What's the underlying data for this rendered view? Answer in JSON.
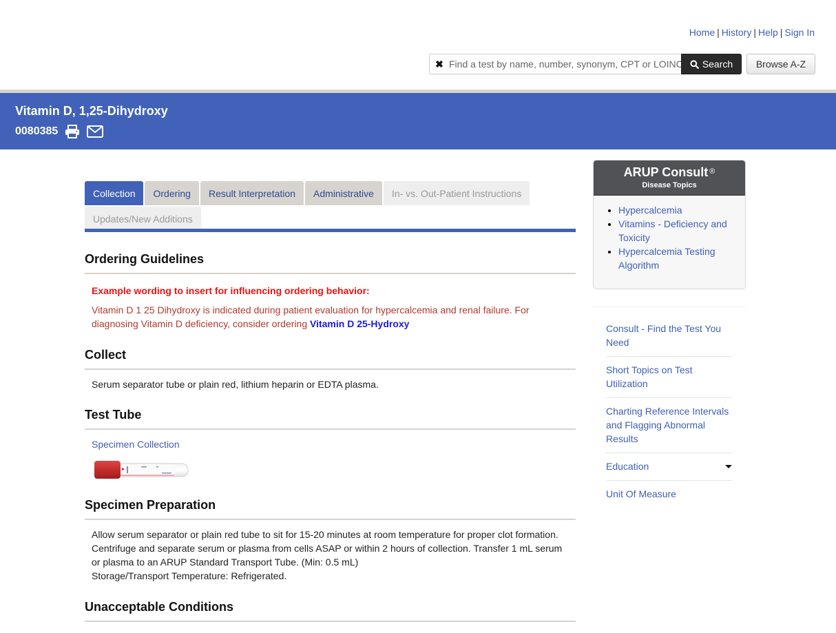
{
  "header": {
    "nav_links": [
      "Home",
      "History",
      "Help",
      "Sign In"
    ],
    "separator": "|",
    "search": {
      "placeholder": "Find a test by name, number, synonym, CPT or LOINC",
      "value": "",
      "clear_icon": "close-icon",
      "search_icon": "magnifier-icon",
      "search_label": "Search"
    },
    "browse_label": "Browse A-Z"
  },
  "banner": {
    "title": "Vitamin D, 1,25-Dihydroxy",
    "code": "0080385",
    "icons": [
      "print-icon",
      "email-icon"
    ]
  },
  "tabs": [
    {
      "label": "Collection",
      "state": "active"
    },
    {
      "label": "Ordering",
      "state": "normal"
    },
    {
      "label": "Result Interpretation",
      "state": "normal"
    },
    {
      "label": "Administrative",
      "state": "normal"
    },
    {
      "label": "In- vs. Out-Patient Instructions",
      "state": "disabled"
    },
    {
      "label": "Updates/New Additions",
      "state": "disabled"
    }
  ],
  "sections": {
    "ordering_guidelines": {
      "heading": "Ordering Guidelines",
      "warning": "Example wording to insert for influencing ordering behavior:",
      "text": "Vitamin D 1 25 Dihydroxy is indicated during patient evaluation for hypercalcemia and renal failure. For diagnosing Vitamin D deficiency, consider ordering ",
      "link": "Vitamin D 25-Hydroxy"
    },
    "collect": {
      "heading": "Collect",
      "text": "Serum separator tube or plain red, lithium heparin or EDTA plasma."
    },
    "test_tube": {
      "heading": "Test Tube",
      "link": "Specimen Collection",
      "image": "red-top-tube"
    },
    "specimen_preparation": {
      "heading": "Specimen Preparation",
      "lines": [
        "Allow serum separator or plain red tube to sit for 15-20 minutes at room temperature for proper clot formation. Centrifuge and separate serum or plasma from cells ASAP or within 2 hours of collection. Transfer 1 mL serum or plasma to an ARUP Standard Transport Tube. (Min: 0.5 mL)",
        "Storage/Transport Temperature: Refrigerated."
      ]
    },
    "unacceptable_conditions": {
      "heading": "Unacceptable Conditions"
    }
  },
  "consult": {
    "brand": "ARUP Consult",
    "reg": "®",
    "subtitle": "Disease Topics",
    "topics": [
      "Hypercalcemia",
      "Vitamins - Deficiency and Toxicity",
      "Hypercalcemia Testing Algorithm"
    ]
  },
  "side_nav": [
    {
      "label": "Consult - Find the Test You Need"
    },
    {
      "label": "Short Topics on Test Utilization"
    },
    {
      "label": "Charting Reference Intervals and Flagging Abnormal Results"
    },
    {
      "label": "Education",
      "has_dropdown": true
    },
    {
      "label": "Unit Of Measure"
    }
  ],
  "colors": {
    "brand_blue": "#4162b8",
    "link_blue": "#3f5fb5",
    "tab_gray": "#d7d3cf",
    "warning_red": "#ee1111",
    "guide_text": "#b03a2e",
    "consult_header": "#505255"
  }
}
